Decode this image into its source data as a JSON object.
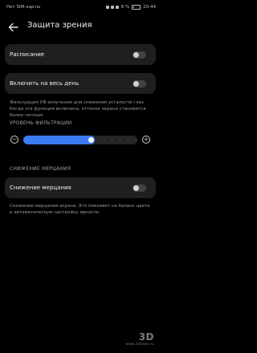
{
  "status_bar": {
    "carrier": "Нет SIM-карты",
    "battery": "8 %",
    "time": "20:44"
  },
  "header": {
    "title": "Защита зрения"
  },
  "schedule": {
    "label": "Расписание",
    "enabled": false
  },
  "all_day": {
    "label": "Включить на весь день",
    "enabled": false
  },
  "filter_description": "Фильтрация УФ-излучения для снижения усталости глаз. Когда эта функция включена, оттенок экрана становится более теплым.",
  "filter_level": {
    "section_title": "УРОВЕНЬ ФИЛЬТРАЦИИ",
    "value_fraction": 0.6
  },
  "flicker": {
    "section_title": "СНИЖЕНИЕ МЕРЦАНИЯ",
    "label": "Снижение мерцания",
    "enabled": false,
    "description": "Снижение мерцания экрана. Это повлияет на баланс цвета и автоматическую настройку яркости."
  },
  "watermark": {
    "logo": "3D",
    "site": "www.3dnews.ru"
  }
}
